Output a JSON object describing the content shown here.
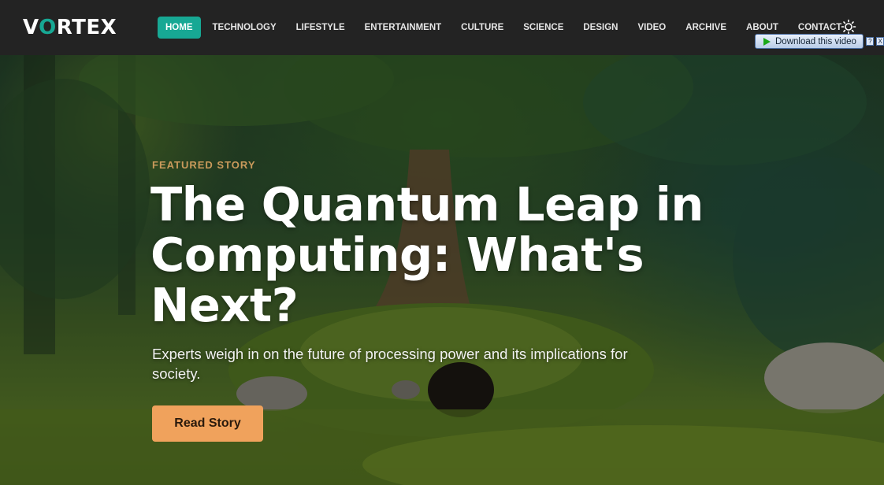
{
  "brand": {
    "logo_prefix": "V",
    "logo_accent": "O",
    "logo_suffix": "RTEX",
    "accent_color": "#17a894"
  },
  "nav": {
    "items": [
      {
        "label": "HOME",
        "active": true
      },
      {
        "label": "TECHNOLOGY"
      },
      {
        "label": "LIFESTYLE"
      },
      {
        "label": "ENTERTAINMENT"
      },
      {
        "label": "CULTURE"
      },
      {
        "label": "SCIENCE"
      },
      {
        "label": "DESIGN"
      },
      {
        "label": "VIDEO"
      },
      {
        "label": "ARCHIVE"
      },
      {
        "label": "ABOUT"
      },
      {
        "label": "CONTACT"
      }
    ],
    "theme_toggle_icon": "sun-icon"
  },
  "download_popup": {
    "label": "Download this video",
    "help_label": "?",
    "close_label": "X"
  },
  "hero": {
    "kicker": "FEATURED STORY",
    "title": "The Quantum Leap in Computing: What's Next?",
    "subtitle": "Experts weigh in on the future of processing power and its implications for society.",
    "cta_label": "Read Story",
    "cta_color": "#f0a25c"
  }
}
